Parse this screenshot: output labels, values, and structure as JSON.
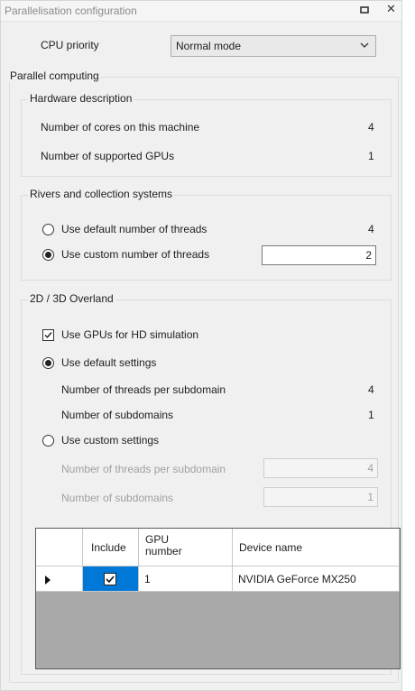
{
  "window": {
    "title": "Parallelisation configuration"
  },
  "cpu_priority": {
    "label": "CPU priority",
    "selected": "Normal mode"
  },
  "parallel_computing": {
    "label": "Parallel computing",
    "hardware": {
      "label": "Hardware description",
      "cores_label": "Number of cores on this machine",
      "cores_value": "4",
      "gpus_label": "Number of supported GPUs",
      "gpus_value": "1"
    },
    "rivers": {
      "label": "Rivers and collection systems",
      "default_label": "Use default number of threads",
      "default_value": "4",
      "custom_label": "Use custom number of threads",
      "custom_value": "2",
      "selected": "custom"
    },
    "overland": {
      "label": "2D / 3D Overland",
      "use_gpus_label": "Use GPUs for HD simulation",
      "use_gpus_checked": true,
      "default_settings_label": "Use default settings",
      "threads_per_subdomain_label": "Number of threads per subdomain",
      "threads_per_subdomain_value": "4",
      "subdomains_label": "Number of subdomains",
      "subdomains_value": "1",
      "custom_settings_label": "Use custom settings",
      "custom_threads_label": "Number of threads per subdomain",
      "custom_threads_value": "4",
      "custom_subdomains_label": "Number of subdomains",
      "custom_subdomains_value": "1",
      "selected": "default"
    }
  },
  "gpu_table": {
    "columns": [
      "Include",
      "GPU number",
      "Device name"
    ],
    "rows": [
      {
        "include": true,
        "gpu_number": "1",
        "device_name": "NVIDIA GeForce MX250"
      }
    ]
  },
  "colors": {
    "selection": "#0078d7",
    "window_bg": "#f0f0f0"
  }
}
